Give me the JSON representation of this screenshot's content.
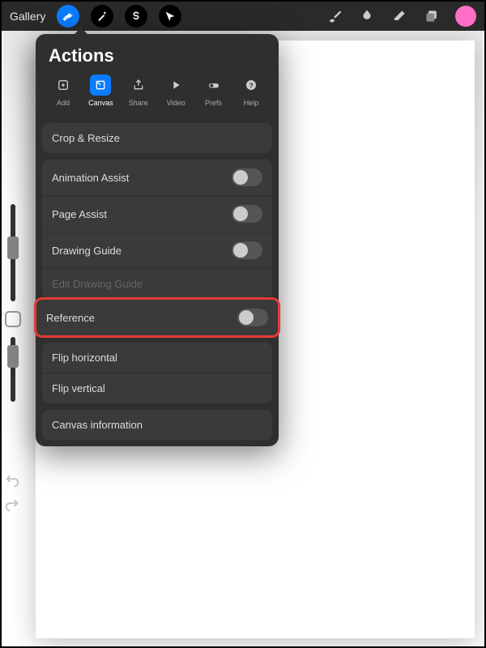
{
  "topbar": {
    "gallery": "Gallery"
  },
  "panel": {
    "title": "Actions",
    "tabs": [
      {
        "label": "Add",
        "icon": "add"
      },
      {
        "label": "Canvas",
        "icon": "canvas"
      },
      {
        "label": "Share",
        "icon": "share"
      },
      {
        "label": "Video",
        "icon": "video"
      },
      {
        "label": "Prefs",
        "icon": "prefs"
      },
      {
        "label": "Help",
        "icon": "help"
      }
    ],
    "sections": {
      "crop": {
        "crop_resize": "Crop & Resize"
      },
      "assist": {
        "animation": "Animation Assist",
        "page": "Page Assist",
        "drawing": "Drawing Guide",
        "edit_guide": "Edit Drawing Guide"
      },
      "reference": {
        "reference": "Reference"
      },
      "flip": {
        "horizontal": "Flip horizontal",
        "vertical": "Flip vertical"
      },
      "info": {
        "canvas_info": "Canvas information"
      }
    }
  },
  "colors": {
    "accent": "#0a7cff",
    "swatch": "#ff6ec7",
    "highlight": "#e53935"
  }
}
